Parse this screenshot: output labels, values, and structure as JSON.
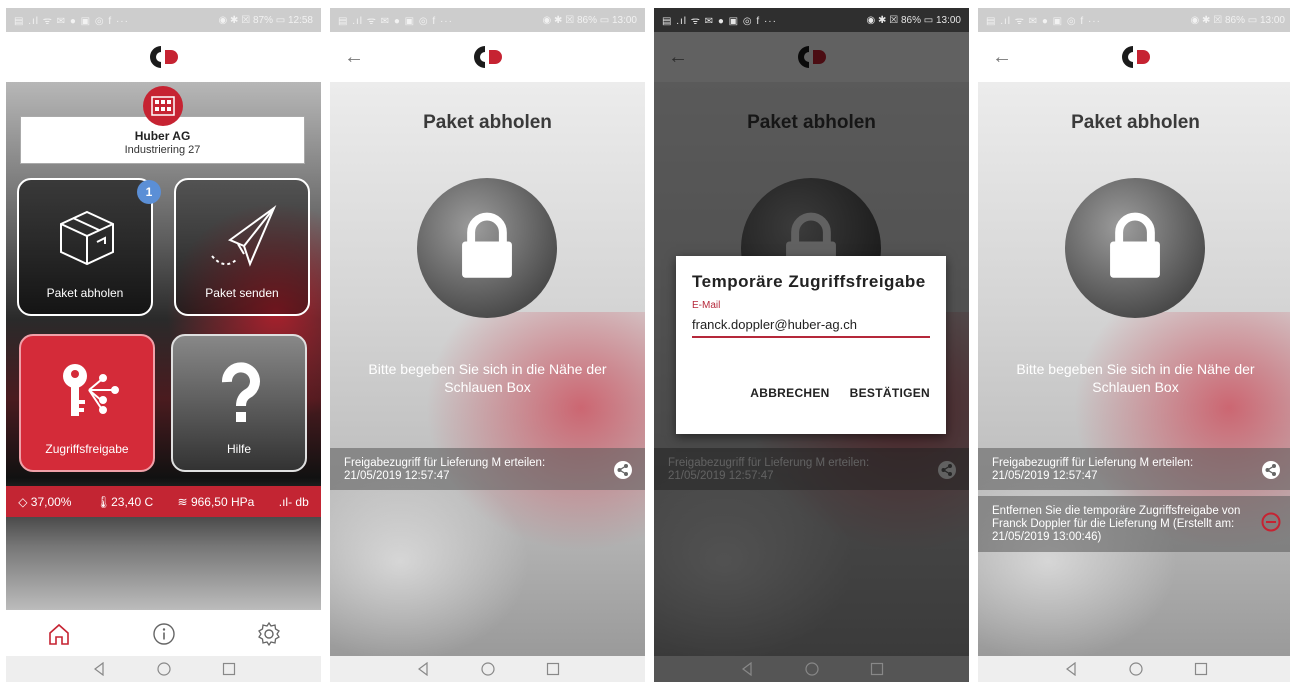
{
  "status": {
    "p1": {
      "left": "▤ .ıl ᯤ ✉ ● ▣ ◎ f ···",
      "right": "◉ ✱ ☒ 87% ▭ 12:58"
    },
    "p2": {
      "left": "▤ .ıl ᯤ ✉ ● ▣ ◎ f ···",
      "right": "◉ ✱ ☒ 86% ▭ 13:00"
    },
    "p3": {
      "left": "▤ .ıl ᯤ ✉ ● ▣ ◎ f ···",
      "right": "◉ ✱ ☒ 86% ▭ 13:00"
    },
    "p4": {
      "left": "▤ .ıl ᯤ ✉ ● ▣ ◎ f ···",
      "right": "◉ ✱ ☒ 86% ▭ 13:00"
    }
  },
  "colors": {
    "brand_red": "#c62332",
    "accent_blue": "#5b8fd6"
  },
  "home": {
    "site_name": "Huber AG",
    "site_address": "Industriering 27",
    "badge_count": "1",
    "tiles": [
      {
        "label": "Paket abholen",
        "icon": "package-icon"
      },
      {
        "label": "Paket senden",
        "icon": "paper-plane-icon"
      },
      {
        "label": "Zugriffsfreigabe",
        "icon": "key-share-icon"
      },
      {
        "label": "Hilfe",
        "icon": "question-icon"
      }
    ],
    "sensors": {
      "humidity": "37,00%",
      "temperature": "23,40 C",
      "pressure": "966,50 HPa",
      "signal": "- db"
    },
    "nav": [
      "home-icon",
      "info-icon",
      "settings-icon"
    ]
  },
  "pickup": {
    "title": "Paket abholen",
    "hint": "Bitte begeben Sie sich in die Nähe der Schlauen Box",
    "access_text": "Freigabezugriff für Lieferung M erteilen: 21/05/2019 12:57:47",
    "removal_text": "Entfernen Sie die temporäre Zugriffsfreigabe von Franck Doppler für die Lieferung M (Erstellt am: 21/05/2019 13:00:46)"
  },
  "dialog": {
    "title": "Temporäre Zugriffsfreigabe",
    "email_label": "E-Mail",
    "email_value": "franck.doppler@huber-ag.ch",
    "cancel_label": "ABBRECHEN",
    "confirm_label": "BESTÄTIGEN"
  }
}
